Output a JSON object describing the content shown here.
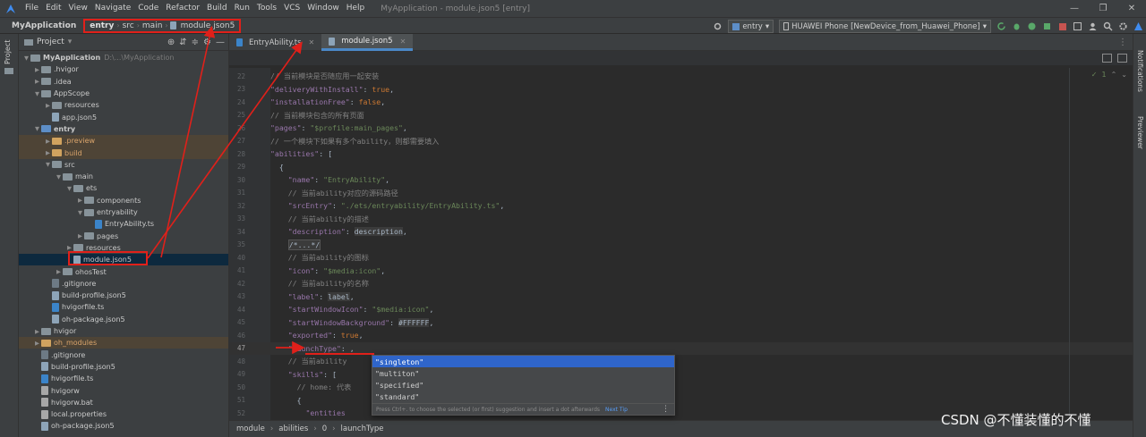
{
  "app": {
    "window_title": "MyApplication - module.json5 [entry]",
    "menu": [
      "File",
      "Edit",
      "View",
      "Navigate",
      "Code",
      "Refactor",
      "Build",
      "Run",
      "Tools",
      "VCS",
      "Window",
      "Help"
    ],
    "window_controls": [
      "—",
      "❐",
      "✕"
    ]
  },
  "navbar": {
    "project": "MyApplication",
    "breadcrumbs": [
      "entry",
      "src",
      "main",
      "module.json5"
    ],
    "run_config": "entry",
    "device": "HUAWEI Phone [NewDevice_from_Huawei_Phone]"
  },
  "side_strip": {
    "project_label": "Project"
  },
  "project_panel": {
    "title": "Project",
    "tree": [
      {
        "label": "MyApplication",
        "path": "D:\\...\\MyApplication",
        "type": "folder-gray",
        "depth": 0,
        "open": true,
        "bold": true
      },
      {
        "label": ".hvigor",
        "type": "folder-gray",
        "depth": 1,
        "open": false
      },
      {
        "label": ".idea",
        "type": "folder-gray",
        "depth": 1,
        "open": false
      },
      {
        "label": "AppScope",
        "type": "folder-gray",
        "depth": 1,
        "open": true
      },
      {
        "label": "resources",
        "type": "folder-gray",
        "depth": 2,
        "open": false
      },
      {
        "label": "app.json5",
        "type": "json",
        "depth": 2
      },
      {
        "label": "entry",
        "type": "folder-blue",
        "depth": 1,
        "open": true,
        "bold": true
      },
      {
        "label": ".preview",
        "type": "folder-orange",
        "depth": 2,
        "open": false,
        "excluded": true
      },
      {
        "label": "build",
        "type": "folder-orange",
        "depth": 2,
        "open": false,
        "excluded": true
      },
      {
        "label": "src",
        "type": "folder-gray",
        "depth": 2,
        "open": true
      },
      {
        "label": "main",
        "type": "folder-gray",
        "depth": 3,
        "open": true
      },
      {
        "label": "ets",
        "type": "folder-gray",
        "depth": 4,
        "open": true
      },
      {
        "label": "components",
        "type": "folder-gray",
        "depth": 5,
        "open": false
      },
      {
        "label": "entryability",
        "type": "folder-gray",
        "depth": 5,
        "open": true
      },
      {
        "label": "EntryAbility.ts",
        "type": "ts",
        "depth": 6
      },
      {
        "label": "pages",
        "type": "folder-gray",
        "depth": 5,
        "open": false
      },
      {
        "label": "resources",
        "type": "folder-gray",
        "depth": 4,
        "open": false
      },
      {
        "label": "module.json5",
        "type": "json",
        "depth": 4,
        "selected": true
      },
      {
        "label": "ohosTest",
        "type": "folder-gray",
        "depth": 3,
        "open": false
      },
      {
        "label": ".gitignore",
        "type": "git",
        "depth": 2
      },
      {
        "label": "build-profile.json5",
        "type": "json",
        "depth": 2
      },
      {
        "label": "hvigorfile.ts",
        "type": "ts",
        "depth": 2
      },
      {
        "label": "oh-package.json5",
        "type": "json",
        "depth": 2
      },
      {
        "label": "hvigor",
        "type": "folder-gray",
        "depth": 1,
        "open": false
      },
      {
        "label": "oh_modules",
        "type": "folder-orange",
        "depth": 1,
        "open": false,
        "excluded": true
      },
      {
        "label": ".gitignore",
        "type": "git",
        "depth": 1
      },
      {
        "label": "build-profile.json5",
        "type": "json",
        "depth": 1
      },
      {
        "label": "hvigorfile.ts",
        "type": "ts",
        "depth": 1
      },
      {
        "label": "hvigorw",
        "type": "txt",
        "depth": 1
      },
      {
        "label": "hvigorw.bat",
        "type": "txt",
        "depth": 1
      },
      {
        "label": "local.properties",
        "type": "txt",
        "depth": 1
      },
      {
        "label": "oh-package.json5",
        "type": "json",
        "depth": 1
      }
    ]
  },
  "editor": {
    "tabs": [
      {
        "label": "EntryAbility.ts",
        "active": false
      },
      {
        "label": "module.json5",
        "active": true
      }
    ],
    "inspection": "1",
    "lines": [
      {
        "n": "22",
        "parts": [
          [
            "com",
            "// 当前模块是否随应用一起安装"
          ]
        ]
      },
      {
        "n": "23",
        "parts": [
          [
            "key",
            "\"deliveryWithInstall\""
          ],
          [
            "plain",
            ": "
          ],
          [
            "kw",
            "true"
          ],
          [
            "plain",
            ","
          ]
        ]
      },
      {
        "n": "24",
        "parts": [
          [
            "key",
            "\"installationFree\""
          ],
          [
            "plain",
            ": "
          ],
          [
            "kw",
            "false"
          ],
          [
            "plain",
            ","
          ]
        ]
      },
      {
        "n": "25",
        "parts": [
          [
            "com",
            "// 当前模块包含的所有页面"
          ]
        ]
      },
      {
        "n": "26",
        "parts": [
          [
            "key",
            "\"pages\""
          ],
          [
            "plain",
            ": "
          ],
          [
            "str",
            "\"$profile:main_pages\""
          ],
          [
            "plain",
            ","
          ]
        ]
      },
      {
        "n": "27",
        "parts": [
          [
            "com",
            "// 一个模块下如果有多个ability，则都需要填入"
          ]
        ]
      },
      {
        "n": "28",
        "parts": [
          [
            "key",
            "\"abilities\""
          ],
          [
            "plain",
            ": ["
          ]
        ]
      },
      {
        "n": "29",
        "parts": [
          [
            "plain",
            "  {"
          ]
        ]
      },
      {
        "n": "30",
        "parts": [
          [
            "plain",
            "    "
          ],
          [
            "key",
            "\"name\""
          ],
          [
            "plain",
            ": "
          ],
          [
            "str",
            "\"EntryAbility\""
          ],
          [
            "plain",
            ","
          ]
        ]
      },
      {
        "n": "31",
        "parts": [
          [
            "plain",
            "    "
          ],
          [
            "com",
            "// 当前ability对应的源码路径"
          ]
        ]
      },
      {
        "n": "32",
        "parts": [
          [
            "plain",
            "    "
          ],
          [
            "key",
            "\"srcEntry\""
          ],
          [
            "plain",
            ": "
          ],
          [
            "str",
            "\"./ets/entryability/EntryAbility.ts\""
          ],
          [
            "plain",
            ","
          ]
        ]
      },
      {
        "n": "33",
        "parts": [
          [
            "plain",
            "    "
          ],
          [
            "com",
            "// 当前ability的描述"
          ]
        ]
      },
      {
        "n": "34",
        "parts": [
          [
            "plain",
            "    "
          ],
          [
            "key",
            "\"description\""
          ],
          [
            "plain",
            ": "
          ],
          [
            "hl",
            "description"
          ],
          [
            "plain",
            ","
          ]
        ]
      },
      {
        "n": "35",
        "parts": [
          [
            "plain",
            "    "
          ],
          [
            "fold",
            "/*...*/"
          ]
        ]
      },
      {
        "n": "40",
        "parts": [
          [
            "plain",
            "    "
          ],
          [
            "com",
            "// 当前ability的图标"
          ]
        ]
      },
      {
        "n": "41",
        "parts": [
          [
            "plain",
            "    "
          ],
          [
            "key",
            "\"icon\""
          ],
          [
            "plain",
            ": "
          ],
          [
            "str",
            "\"$media:icon\""
          ],
          [
            "plain",
            ","
          ]
        ]
      },
      {
        "n": "42",
        "parts": [
          [
            "plain",
            "    "
          ],
          [
            "com",
            "// 当前ability的名称"
          ]
        ]
      },
      {
        "n": "43",
        "parts": [
          [
            "plain",
            "    "
          ],
          [
            "key",
            "\"label\""
          ],
          [
            "plain",
            ": "
          ],
          [
            "hl",
            "label"
          ],
          [
            "plain",
            ","
          ]
        ]
      },
      {
        "n": "44",
        "parts": [
          [
            "plain",
            "    "
          ],
          [
            "key",
            "\"startWindowIcon\""
          ],
          [
            "plain",
            ": "
          ],
          [
            "str",
            "\"$media:icon\""
          ],
          [
            "plain",
            ","
          ]
        ]
      },
      {
        "n": "45",
        "parts": [
          [
            "plain",
            "    "
          ],
          [
            "key",
            "\"startWindowBackground\""
          ],
          [
            "plain",
            ": "
          ],
          [
            "hl",
            "#FFFFFF"
          ],
          [
            "plain",
            ","
          ]
        ]
      },
      {
        "n": "46",
        "parts": [
          [
            "plain",
            "    "
          ],
          [
            "key",
            "\"exported\""
          ],
          [
            "plain",
            ": "
          ],
          [
            "kw",
            "true"
          ],
          [
            "plain",
            ","
          ]
        ]
      },
      {
        "n": "47",
        "parts": [
          [
            "plain",
            "    "
          ],
          [
            "key",
            "\"launchType\""
          ],
          [
            "plain",
            ": ,"
          ]
        ],
        "current": true
      },
      {
        "n": "48",
        "parts": [
          [
            "plain",
            "    "
          ],
          [
            "com",
            "// 当前ability"
          ]
        ]
      },
      {
        "n": "49",
        "parts": [
          [
            "plain",
            "    "
          ],
          [
            "key",
            "\"skills\""
          ],
          [
            "plain",
            ": ["
          ]
        ]
      },
      {
        "n": "50",
        "parts": [
          [
            "plain",
            "      "
          ],
          [
            "com",
            "// home: 代表"
          ]
        ]
      },
      {
        "n": "51",
        "parts": [
          [
            "plain",
            "      {"
          ]
        ]
      },
      {
        "n": "52",
        "parts": [
          [
            "plain",
            "        "
          ],
          [
            "key",
            "\"entities"
          ]
        ]
      }
    ]
  },
  "completion": {
    "items": [
      "\"singleton\"",
      "\"multiton\"",
      "\"specified\"",
      "\"standard\""
    ],
    "footer": "Press Ctrl+. to choose the selected (or first) suggestion and insert a dot afterwards",
    "tip_link": "Next Tip",
    "more": "⋮"
  },
  "statusbar": {
    "path": [
      "module",
      "abilities",
      "0",
      "launchType"
    ]
  },
  "right_strip": [
    "Notifications",
    "Previewer"
  ],
  "watermark": "CSDN @不懂装懂的不懂",
  "colors": {
    "annotation_red": "#e0201a",
    "selection_blue": "#2f65ca",
    "accent_tab": "#4a88c7"
  }
}
